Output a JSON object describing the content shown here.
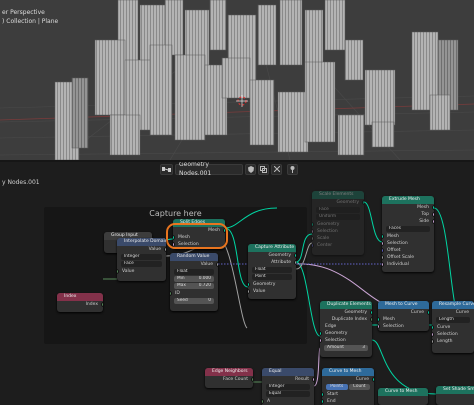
{
  "viewport": {
    "info_lines": [
      "er Perspective",
      ") Collection | Plane"
    ],
    "object": "city-blocks",
    "cursor": "3d-cursor-icon"
  },
  "header": {
    "editor_icon": "node-editor-icon",
    "tree_name": "Geometry Nodes.001",
    "fake_user_icon": "shield-icon",
    "duplicate_icon": "duplicate-icon",
    "unlink_icon": "close-icon",
    "pin_icon": "pin-icon"
  },
  "breadcrumb": "y Nodes.001",
  "frame": {
    "label": "Capture here"
  },
  "colors": {
    "geometry": "#00d6a3",
    "float": "#a1a1a1",
    "vector": "#6363c7",
    "integer": "#598c5c",
    "boolean": "#cca6d6",
    "attribute_header": "#1d725e",
    "input_header": "#83314a",
    "curve_header": "#2e6a9a",
    "accent_highlight": "#e8751f"
  },
  "nodes": {
    "group_input": {
      "title": "Group Input",
      "geometry": "Geometry"
    },
    "split_edges": {
      "title": "Split Edges",
      "mesh_out": "Mesh",
      "mesh_in": "Mesh",
      "selection": "Selection"
    },
    "random_value": {
      "title": "Random Value",
      "value": "Value",
      "type": "Float",
      "min_label": "Min",
      "min_value": "0.000",
      "max_label": "Max",
      "max_value": "0.720",
      "id": "ID",
      "seed_label": "Seed",
      "seed_value": "0"
    },
    "interpolate_domain": {
      "title": "Interpolate Domain",
      "value_out": "Value",
      "type": "Integer",
      "domain": "Face",
      "value_in": "Value"
    },
    "index": {
      "title": "Index",
      "index": "Index"
    },
    "capture_attribute": {
      "title": "Capture Attribute",
      "geometry_out": "Geometry",
      "attribute_out": "Attribute",
      "type": "Float",
      "domain": "Point",
      "geometry_in": "Geometry",
      "value_in": "Value"
    },
    "scale_elements": {
      "title": "Scale Elements",
      "geometry_out": "Geometry",
      "domain": "Face",
      "mode": "Uniform",
      "geometry_in": "Geometry",
      "selection": "Selection",
      "scale": "Scale",
      "center": "Center"
    },
    "extrude_mesh": {
      "title": "Extrude Mesh",
      "mesh_out": "Mesh",
      "top": "Top",
      "side": "Side",
      "mode": "Faces",
      "mesh_in": "Mesh",
      "selection": "Selection",
      "offset": "Offset",
      "offset_scale": "Offset Scale",
      "individual": "Individual"
    },
    "duplicate_elements": {
      "title": "Duplicate Elements",
      "geometry_out": "Geometry",
      "duplicate_index": "Duplicate Index",
      "domain": "Edge",
      "geometry_in": "Geometry",
      "selection": "Selection",
      "amount_label": "Amount",
      "amount_value": "3"
    },
    "mesh_to_curve": {
      "title": "Mesh to Curve",
      "curve_out": "Curve",
      "mesh_in": "Mesh",
      "selection": "Selection"
    },
    "resample_curve": {
      "title": "Resample Curve",
      "curve_out": "Curve",
      "mode": "Length",
      "curve_in": "Curve",
      "selection": "Selection",
      "length": "Length"
    },
    "edge_neighbors": {
      "title": "Edge Neighbors",
      "face_count": "Face Count"
    },
    "equal": {
      "title": "Equal",
      "result": "Result",
      "type": "Integer",
      "compare": "Equal",
      "a": "A"
    },
    "curve_to_mesh": {
      "title": "Curve to Mesh",
      "curve": "Curve",
      "points": "Points",
      "cap": "Count",
      "start": "Start",
      "end": "End"
    },
    "set_shade_smooth": {
      "title": "Set Shade Smoo"
    }
  }
}
